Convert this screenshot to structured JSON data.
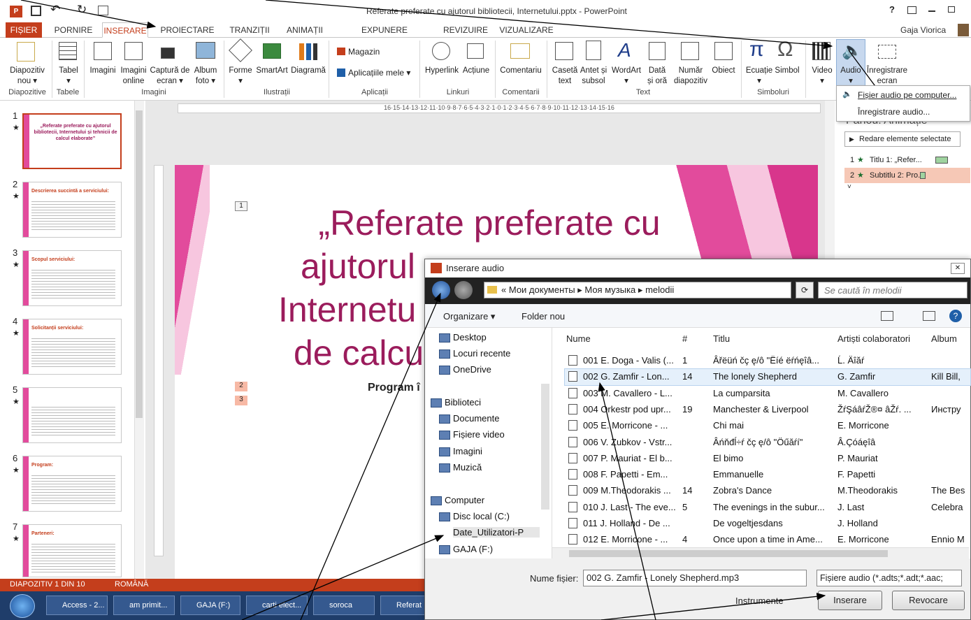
{
  "window": {
    "title": "Referate preferate cu ajutorul bibliotecii, Internetului.pptx - PowerPoint",
    "help": "?",
    "user": "Gaja Viorica"
  },
  "tabs": [
    "FIȘIER",
    "PORNIRE",
    "INSERARE",
    "PROIECTARE",
    "TRANZIȚII",
    "ANIMAȚII",
    "EXPUNERE DIAPOZITIVE",
    "REVIZUIRE",
    "VIZUALIZARE"
  ],
  "ribbon": {
    "buttons": [
      {
        "l1": "Diapozitiv",
        "l2": "nou ▾"
      },
      {
        "l1": "Tabel",
        "l2": "▾"
      },
      {
        "l1": "Imagini",
        "l2": ""
      },
      {
        "l1": "Imagini",
        "l2": "online"
      },
      {
        "l1": "Captură de",
        "l2": "ecran ▾"
      },
      {
        "l1": "Album",
        "l2": "foto ▾"
      },
      {
        "l1": "Forme",
        "l2": "▾"
      },
      {
        "l1": "SmartArt",
        "l2": ""
      },
      {
        "l1": "Diagramă",
        "l2": ""
      },
      {
        "l1": "Hyperlink",
        "l2": ""
      },
      {
        "l1": "Acțiune",
        "l2": ""
      },
      {
        "l1": "Comentariu",
        "l2": ""
      },
      {
        "l1": "Casetă",
        "l2": "text"
      },
      {
        "l1": "Antet și",
        "l2": "subsol"
      },
      {
        "l1": "WordArt",
        "l2": "▾"
      },
      {
        "l1": "Dată",
        "l2": "și oră"
      },
      {
        "l1": "Număr",
        "l2": "diapozitiv"
      },
      {
        "l1": "Obiect",
        "l2": ""
      },
      {
        "l1": "Ecuație",
        "l2": "▾"
      },
      {
        "l1": "Simbol",
        "l2": ""
      },
      {
        "l1": "Video",
        "l2": "▾"
      },
      {
        "l1": "Audio",
        "l2": "▾"
      },
      {
        "l1": "Înregistrare",
        "l2": "ecran"
      }
    ],
    "store": "Magazin",
    "myapps": "Aplicațiile mele ▾",
    "groups": [
      "Diapozitive",
      "Tabele",
      "Imagini",
      "Ilustrații",
      "Aplicații",
      "Linkuri",
      "Comentarii",
      "Text",
      "Simboluri"
    ]
  },
  "audio_menu": [
    "Fișier audio pe computer...",
    "Înregistrare audio..."
  ],
  "animation_pane": {
    "title": "Panou: Animație",
    "play": "Redare elemente selectate",
    "items": [
      "Titlu 1: „Refer...",
      "Subtitlu 2: Pro..."
    ],
    "item_nums": [
      "1",
      "2"
    ]
  },
  "slides": [
    {
      "num": "1",
      "text": "„Referate preferate cu ajutorul bibliotecii, Internetului și tehnicii de calcul elaborate”"
    },
    {
      "num": "2",
      "text": "Descrierea succintă a serviciului:"
    },
    {
      "num": "3",
      "text": "Scopul serviciului:"
    },
    {
      "num": "4",
      "text": "Solicitanții serviciului:"
    },
    {
      "num": "5",
      "text": ""
    },
    {
      "num": "6",
      "text": "Program:"
    },
    {
      "num": "7",
      "text": "Parteneri:"
    }
  ],
  "ruler": "16·15·14·13·12·11·10·9·8·7·6·5·4·3·2·1·0·1·2·3·4·5·6·7·8·9·10·11·12·13·14·15·16",
  "slide_main": {
    "title_lines": [
      "„Referate preferate cu",
      "ajutorul",
      "Internetu",
      "de calcu"
    ],
    "subtitle": "Program î",
    "tags": [
      "1",
      "2",
      "3"
    ]
  },
  "status": {
    "slide": "DIAPOZITIV 1 DIN 10",
    "lang": "ROMÂNĂ"
  },
  "taskbar": [
    "Access - 2...",
    "am primit...",
    "GAJA (F:)",
    "carti elect...",
    "soroca",
    "Referat"
  ],
  "dialog": {
    "title": "Inserare audio",
    "close": "✕",
    "breadcrumb": [
      "« Мои документы",
      "Моя музыка",
      "melodii"
    ],
    "search_placeholder": "Se caută în melodii",
    "organize": "Organizare ▾",
    "new_folder": "Folder nou",
    "nav": [
      "Desktop",
      "Locuri recente",
      "OneDrive",
      "Biblioteci",
      "Documente",
      "Fișiere video",
      "Imagini",
      "Muzică",
      "Computer",
      "Disc local (C:)",
      "Date_Utilizatori-P",
      "GAJA (F:)"
    ],
    "columns": [
      "Nume",
      "#",
      "Titlu",
      "Artiști colaboratori",
      "Album"
    ],
    "files": [
      {
        "name": "001 E. Doga - Valis (...",
        "num": "1",
        "title": "Âřëüń čç ę/ô \"Ëíé ëŕńęîâ...",
        "artist": "Ĺ. Äîăŕ",
        "album": ""
      },
      {
        "name": "002 G. Zamfir - Lon...",
        "num": "14",
        "title": "The lonely Shepherd",
        "artist": "G. Zamfir",
        "album": "Kill Bill,"
      },
      {
        "name": "003 M. Cavallero - L...",
        "num": "",
        "title": "La cumparsita",
        "artist": "M. Cavallero",
        "album": ""
      },
      {
        "name": "004 Orkestr pod upr...",
        "num": "19",
        "title": "Manchester & Liverpool",
        "artist": "ŽŕŞáâŕŽ®¤ âŽŕ. ...",
        "album": "Инстру"
      },
      {
        "name": "005 E. Morricone - ...",
        "num": "",
        "title": "Chi mai",
        "artist": "E. Morricone",
        "album": ""
      },
      {
        "name": "006 V. Zubkov - Vstr...",
        "num": "",
        "title": "Âńňđĺ÷ŕ čç ę/ô \"Öűăŕí\"",
        "artist": "Â.Çóáęîâ",
        "album": ""
      },
      {
        "name": "007 P. Mauriat - El b...",
        "num": "",
        "title": "El bimo",
        "artist": "P. Mauriat",
        "album": ""
      },
      {
        "name": "008 F. Papetti - Em...",
        "num": "",
        "title": "Emmanuelle",
        "artist": "F. Papetti",
        "album": ""
      },
      {
        "name": "009 M.Theodorakis ...",
        "num": "14",
        "title": "Zobra's Dance",
        "artist": "M.Theodorakis",
        "album": "The Bes"
      },
      {
        "name": "010 J. Last - The eve...",
        "num": "5",
        "title": "The evenings in the subur...",
        "artist": "J. Last",
        "album": "Celebra"
      },
      {
        "name": "011 J. Holland - De ...",
        "num": "",
        "title": "De vogeltjesdans",
        "artist": "J. Holland",
        "album": ""
      },
      {
        "name": "012 E. Morricone - ...",
        "num": "4",
        "title": "Once upon a time in Ame...",
        "artist": "E. Morricone",
        "album": "Ennio M"
      }
    ],
    "filename_label": "Nume fișier:",
    "filename_value": "002 G. Zamfir - Lonely Shepherd.mp3",
    "filetype": "Fișiere audio (*.adts;*.adt;*.aac;",
    "tools": "Instrumente",
    "insert": "Inserare",
    "cancel": "Revocare"
  },
  "colors": {
    "accent": "#c43e1c",
    "slide_title": "#9b1c5c",
    "selection": "#cce8ff"
  }
}
